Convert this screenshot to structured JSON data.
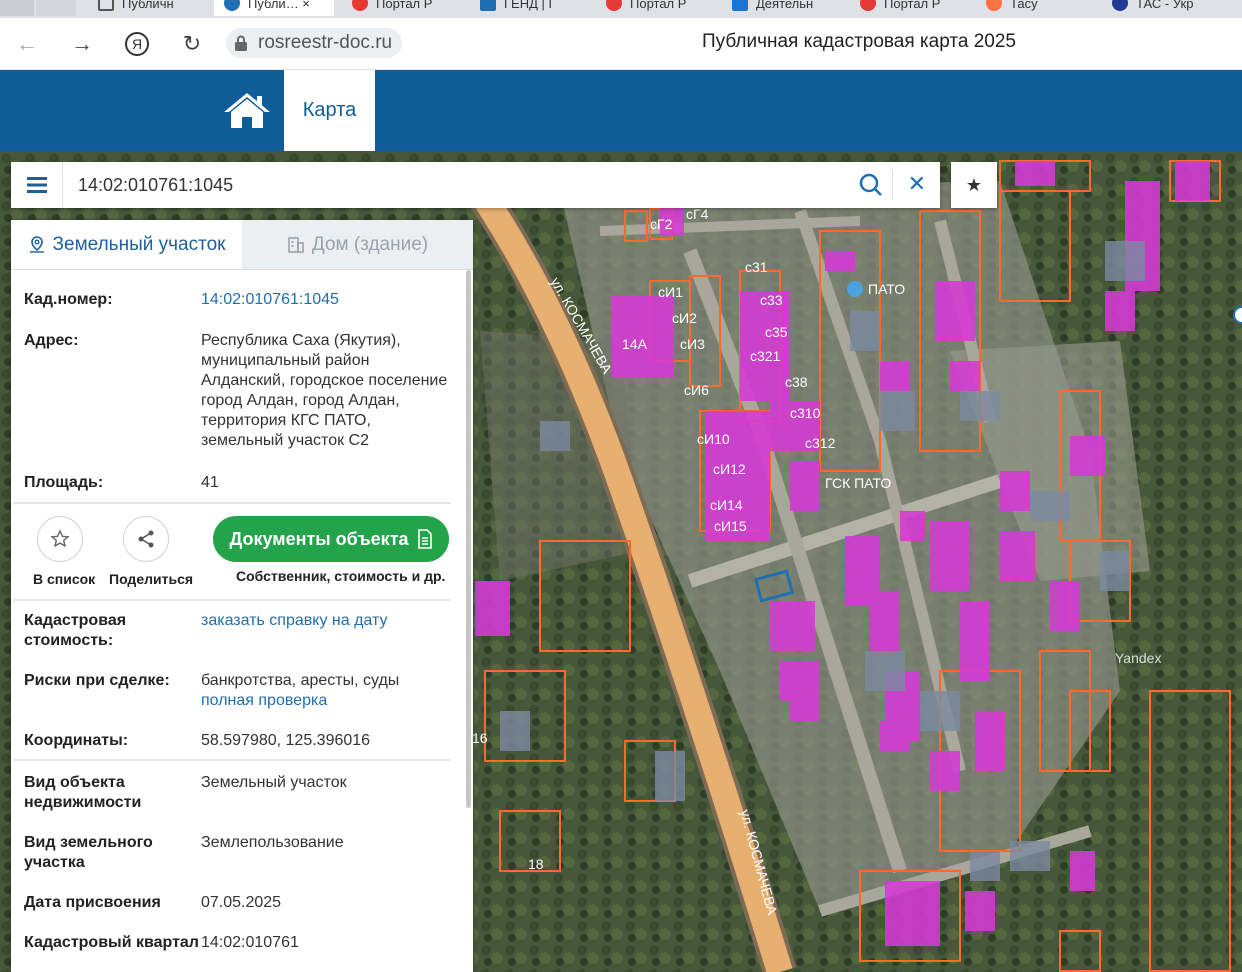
{
  "browser": {
    "tabs": [
      {
        "label": "Публичн",
        "color": "#f5f5f5"
      },
      {
        "label": "Публи… ×",
        "color": "#1f6fb2"
      },
      {
        "label": "Портал Р",
        "color": "#e53935"
      },
      {
        "label": "ГЕНД | Г",
        "color": "#1f6fb2"
      },
      {
        "label": "Портал Р",
        "color": "#e53935"
      },
      {
        "label": "Деятельн",
        "color": "#1976d2"
      },
      {
        "label": "Портал Р",
        "color": "#e53935"
      },
      {
        "label": "Тасу",
        "color": "#ff7043"
      },
      {
        "label": "ТАС - Укр",
        "color": "#1f3a93"
      }
    ],
    "url": "rosreestr-doc.ru",
    "page_title": "Публичная кадастровая карта 2025"
  },
  "header": {
    "map_tab": "Карта"
  },
  "search": {
    "value": "14:02:010761:1045"
  },
  "panel": {
    "tab_land": "Земельный участок",
    "tab_house": "Дом (здание)",
    "rows_top": [
      {
        "label": "Кад.номер:",
        "value": "14:02:010761:1045",
        "link": true
      },
      {
        "label": "Адрес:",
        "value": "Республика Саха (Якутия), муниципальный район Алданский, городское поселение город Алдан, город Алдан, территория КГС ПАТО, земельный участок С2",
        "link": false
      },
      {
        "label": "Площадь:",
        "value": "41",
        "link": false
      }
    ],
    "actions": {
      "to_list": "В список",
      "share": "Поделиться",
      "docs_button": "Документы объекта",
      "docs_sub": "Собственник, стоимость и др."
    },
    "cad_value": {
      "label": "Кадастровая стоимость:",
      "value": "заказать справку на дату"
    },
    "risks": {
      "label": "Риски при сделке:",
      "value": "банкротства, аресты, суды",
      "link": "полная проверка"
    },
    "coords": {
      "label": "Координаты:",
      "value": "58.597980, 125.396016"
    },
    "rows_bottom": [
      {
        "label": "Вид объекта недвижимости",
        "value": "Земельный участок"
      },
      {
        "label": "Вид земельного участка",
        "value": "Землепользование"
      },
      {
        "label": "Дата присвоения",
        "value": "07.05.2025"
      },
      {
        "label": "Кадастровый квартал",
        "value": "14:02:010761"
      }
    ]
  },
  "map": {
    "labels": [
      "ул. КОСМАЧЕВА",
      "ул. КОСМАЧЕВА",
      "ПАТО",
      "ГСК ПАТО",
      "14А",
      "сИ1",
      "сИ2",
      "сИ3",
      "сИ6",
      "сИ10",
      "сИ12",
      "сИ14",
      "сИ15",
      "с31",
      "с33",
      "с35",
      "с321",
      "с38",
      "с310",
      "с312",
      "сГ2",
      "сГ4",
      "18",
      "16",
      "Yandex"
    ]
  }
}
